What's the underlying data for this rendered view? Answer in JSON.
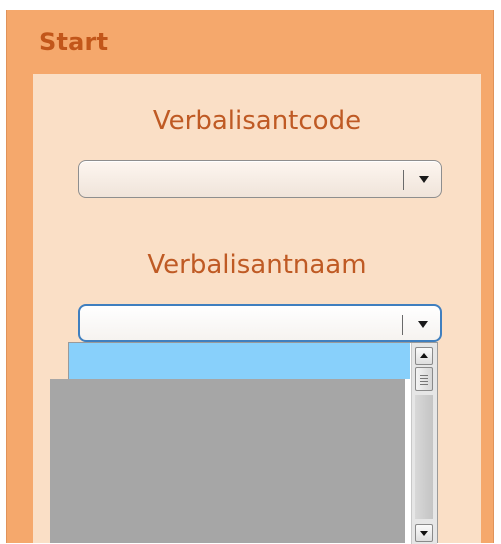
{
  "panel": {
    "title": "Start"
  },
  "fields": {
    "code": {
      "label": "Verbalisantcode",
      "value": ""
    },
    "name": {
      "label": "Verbalisantnaam",
      "value": ""
    }
  },
  "dropdown": {
    "options": [],
    "highlight_color": "#88d0fb"
  },
  "colors": {
    "panel": "#f5a86c",
    "inner": "#fadfc6",
    "title": "#c2561a",
    "label": "#bf5a24",
    "focus_border": "#3f7fbf",
    "redaction": "#a6a6a6"
  },
  "icons": {
    "select_caret": "chevron-down-icon",
    "scroll_up": "arrow-up-icon",
    "scroll_down": "arrow-down-icon"
  }
}
